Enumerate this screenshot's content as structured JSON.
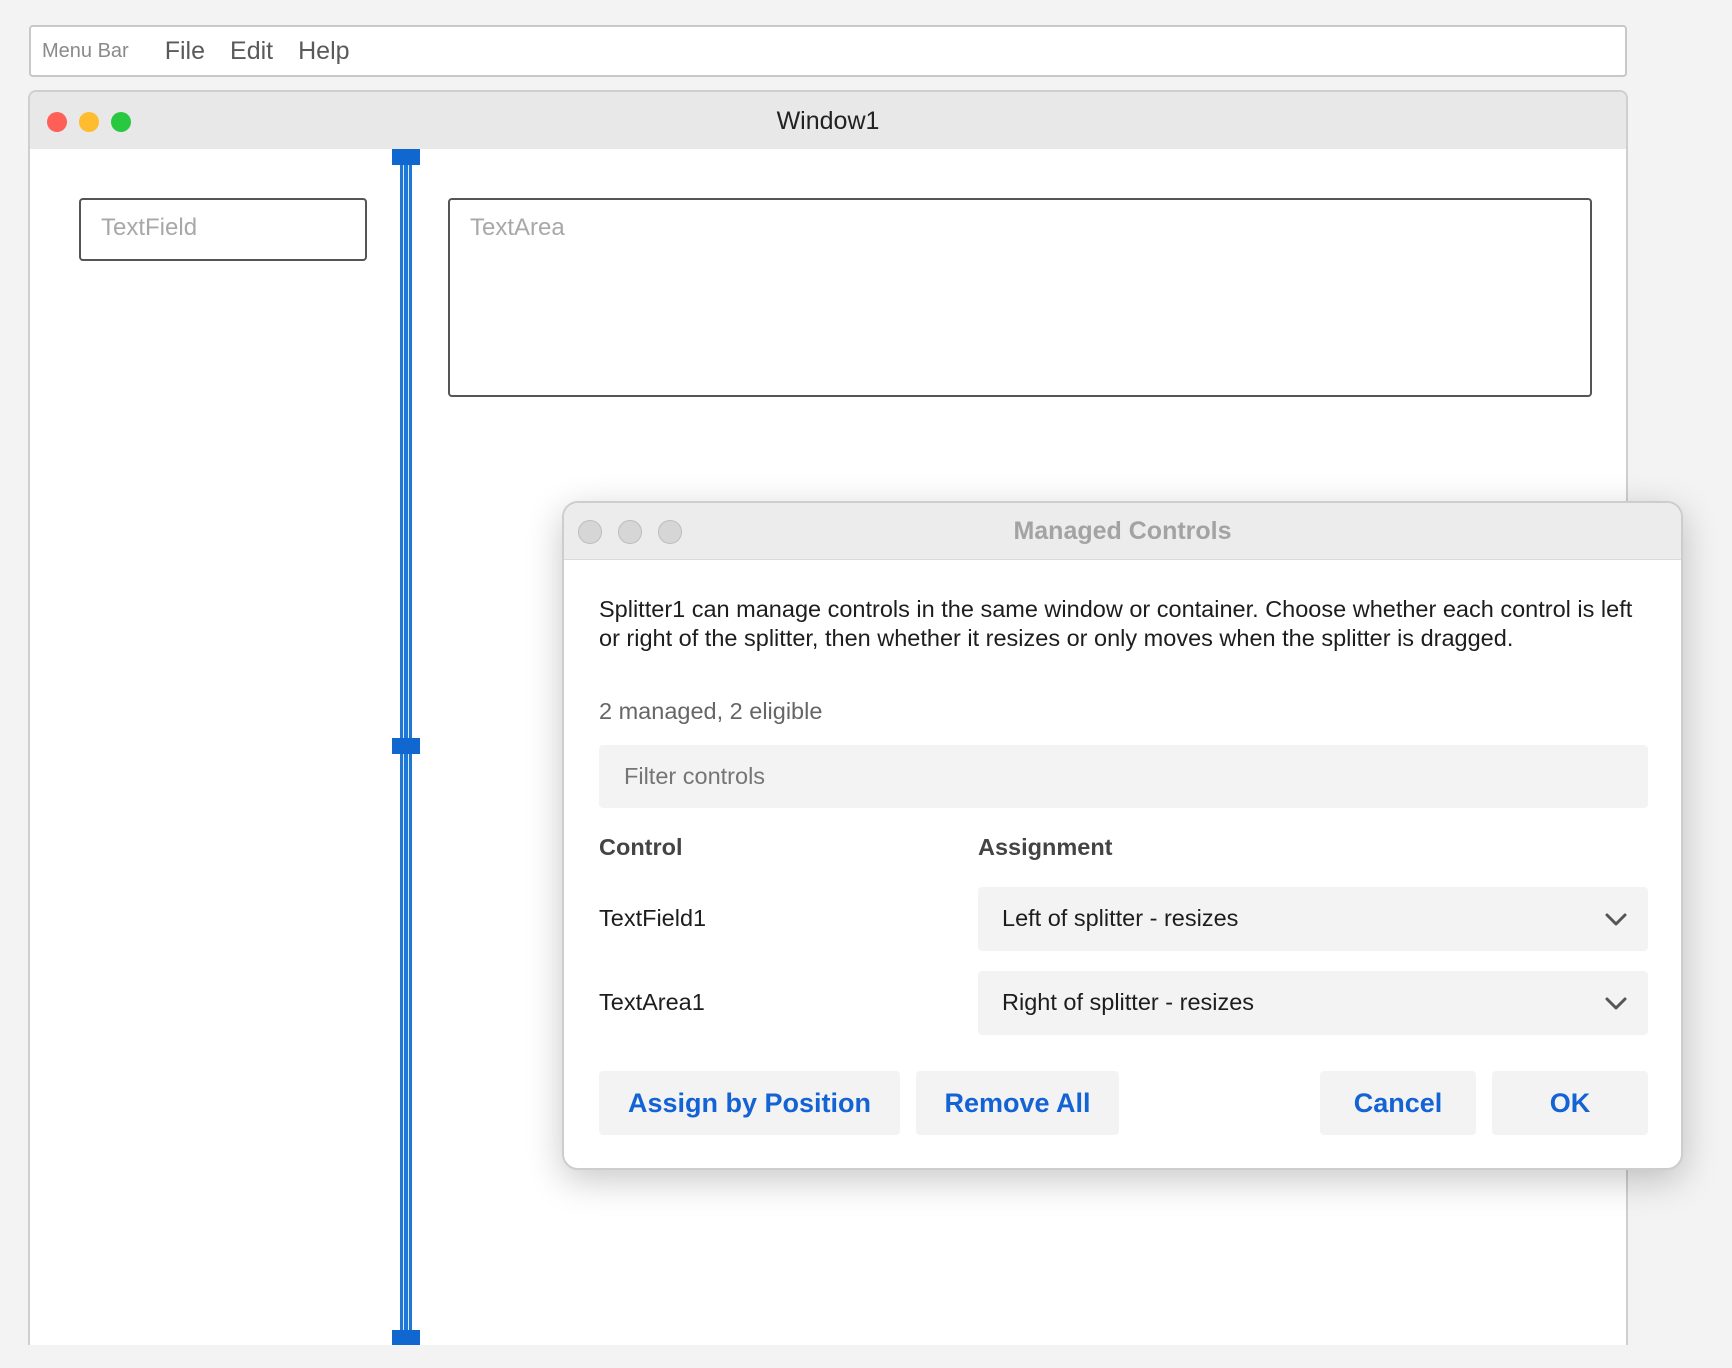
{
  "menubar": {
    "label": "Menu Bar",
    "items": [
      "File",
      "Edit",
      "Help"
    ]
  },
  "window": {
    "title": "Window1",
    "textfield_placeholder": "TextField",
    "textarea_placeholder": "TextArea"
  },
  "dialog": {
    "title": "Managed Controls",
    "description": "Splitter1 can manage controls in the same window or container. Choose whether each control is left or right of the splitter, then whether it resizes or only moves when the splitter is dragged.",
    "count": "2 managed, 2 eligible",
    "filter_placeholder": "Filter controls",
    "columns": {
      "control": "Control",
      "assignment": "Assignment"
    },
    "rows": [
      {
        "control": "TextField1",
        "assignment": "Left of splitter - resizes"
      },
      {
        "control": "TextArea1",
        "assignment": "Right of splitter - resizes"
      }
    ],
    "buttons": {
      "assign_by_position": "Assign by Position",
      "remove_all": "Remove All",
      "cancel": "Cancel",
      "ok": "OK"
    }
  },
  "colors": {
    "accent": "#1463d4",
    "splitter": "#1e78d7",
    "close": "#fe5f57",
    "minimize": "#febc2e",
    "maximize": "#28c840"
  }
}
